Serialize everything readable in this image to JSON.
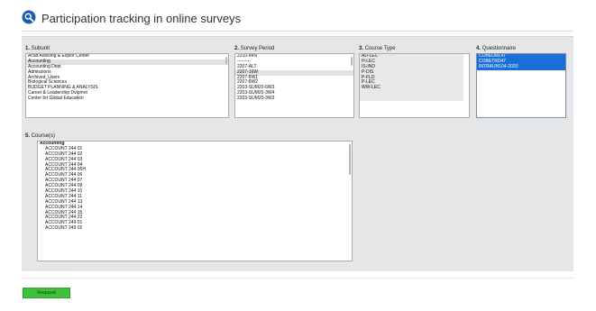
{
  "page": {
    "title": "Participation tracking in online surveys",
    "logo_icon": "magnifier-logo-icon"
  },
  "colors": {
    "panel_bg": "#e4e6e8",
    "selected_blue": "#1a6ed8",
    "request_green": "#3fc13a"
  },
  "subunit": {
    "number": "1.",
    "label": "Subunit",
    "items": [
      {
        "text": "Acad Advising & Explor Center",
        "selected": false
      },
      {
        "text": "Accounting",
        "selected": true
      },
      {
        "text": "Accounting Dept",
        "selected": false
      },
      {
        "text": "Admissions",
        "selected": false
      },
      {
        "text": "Archived_Users",
        "selected": false
      },
      {
        "text": "Biological Sciences",
        "selected": false
      },
      {
        "text": "BUDGET PLANNING & ANALYSIS",
        "selected": false
      },
      {
        "text": "Career & Leadership Dvlpmnt",
        "selected": false
      },
      {
        "text": "Center for Global Education",
        "selected": false
      }
    ]
  },
  "survey_period": {
    "number": "2.",
    "label": "Survey Period",
    "items": [
      {
        "text": "2210-MIN",
        "selected": false
      },
      {
        "text": "---------",
        "selected": false
      },
      {
        "text": "2207-ALT",
        "selected": false
      },
      {
        "text": "2207-16W",
        "selected": true
      },
      {
        "text": "2207-8W1",
        "selected": false
      },
      {
        "text": "2207-8W2",
        "selected": false
      },
      {
        "text": "2203-SUM20-6W3",
        "selected": false
      },
      {
        "text": "2203-SUM20-3W4",
        "selected": false
      },
      {
        "text": "2203-SUM20-3W3",
        "selected": false
      }
    ]
  },
  "course_type": {
    "number": "3.",
    "label": "Course Type",
    "items": [
      {
        "text": "AD-LEC"
      },
      {
        "text": "H-LEC"
      },
      {
        "text": "IS-IND"
      },
      {
        "text": "P-DIS"
      },
      {
        "text": "P-FLD"
      },
      {
        "text": "P-LEC"
      },
      {
        "text": "WW-LEC"
      }
    ]
  },
  "questionnaire": {
    "number": "4.",
    "label": "Questionnaire",
    "items": [
      {
        "text": "COBEONL47"
      },
      {
        "text": "COBETRD47"
      },
      {
        "text": "INTRAUN104-2020"
      }
    ]
  },
  "courses": {
    "number": "5.",
    "label": "Course(s)",
    "group": "Accounting",
    "items": [
      "ACCOUNT 244 01",
      "ACCOUNT 244 02",
      "ACCOUNT 244 03",
      "ACCOUNT 244 04",
      "ACCOUNT 244 05H",
      "ACCOUNT 244 06",
      "ACCOUNT 244 07",
      "ACCOUNT 244 09",
      "ACCOUNT 244 10",
      "ACCOUNT 244 11",
      "ACCOUNT 244 13",
      "ACCOUNT 244 14",
      "ACCOUNT 244 15",
      "ACCOUNT 244 22",
      "ACCOUNT 249 01",
      "ACCOUNT 249 02"
    ]
  },
  "actions": {
    "request_label": "Request"
  }
}
